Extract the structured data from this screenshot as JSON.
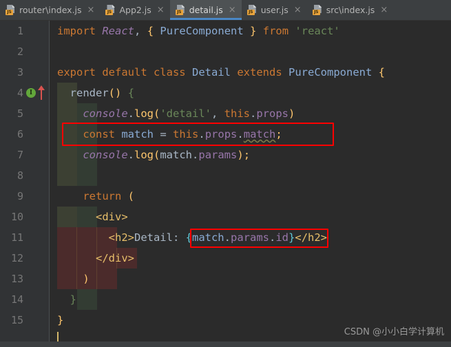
{
  "window": {
    "app": "IntelliJ-style code editor",
    "theme_bg": "#2b2b2b",
    "tabbar_bg": "#3c3f41",
    "active_tab_bg": "#4e5254",
    "active_tab_underline": "#4a88c7",
    "annotation_color": "#ff0000"
  },
  "tabs": [
    {
      "label": "router\\index.js",
      "icon": "js-file-icon",
      "badge": "JS",
      "close": "×",
      "active": false
    },
    {
      "label": "App2.js",
      "icon": "js-file-icon",
      "badge": "JS",
      "close": "×",
      "active": false
    },
    {
      "label": "detail.js",
      "icon": "js-file-icon",
      "badge": "JS",
      "close": "×",
      "active": true
    },
    {
      "label": "user.js",
      "icon": "js-file-icon",
      "badge": "JS",
      "close": "×",
      "active": false
    },
    {
      "label": "src\\index.js",
      "icon": "js-file-icon",
      "badge": "JS",
      "close": "×",
      "active": false
    }
  ],
  "gutter": {
    "line_numbers": [
      "1",
      "2",
      "3",
      "4",
      "5",
      "6",
      "7",
      "8",
      "9",
      "10",
      "11",
      "12",
      "13",
      "14",
      "15"
    ],
    "markers": [
      {
        "line": 4,
        "name": "implements-method-marker",
        "glyph": "I",
        "color": "#62a73b"
      },
      {
        "line": 4,
        "name": "override-up-arrow-marker",
        "glyph": "↑",
        "color": "#d9534f"
      }
    ],
    "fold_markers": [
      {
        "line": 3,
        "type": "collapse-start"
      },
      {
        "line": 4,
        "type": "collapse-start"
      },
      {
        "line": 10,
        "type": "collapse-start"
      },
      {
        "line": 12,
        "type": "collapse-end"
      },
      {
        "line": 14,
        "type": "collapse-end"
      },
      {
        "line": 15,
        "type": "collapse-end"
      }
    ]
  },
  "code": {
    "file": "detail.js",
    "lines": [
      {
        "n": 1,
        "text": "import React, { PureComponent } from 'react'"
      },
      {
        "n": 2,
        "text": ""
      },
      {
        "n": 3,
        "text": "export default class Detail extends PureComponent {"
      },
      {
        "n": 4,
        "text": "    render() {"
      },
      {
        "n": 5,
        "text": "        console.log('detail', this.props)"
      },
      {
        "n": 6,
        "text": "        const match = this.props.match;"
      },
      {
        "n": 7,
        "text": "        console.log(match.params);"
      },
      {
        "n": 8,
        "text": ""
      },
      {
        "n": 9,
        "text": "        return ("
      },
      {
        "n": 10,
        "text": "            <div>"
      },
      {
        "n": 11,
        "text": "                <h2>Detail: {match.params.id}</h2>"
      },
      {
        "n": 12,
        "text": "            </div>"
      },
      {
        "n": 13,
        "text": "        )"
      },
      {
        "n": 14,
        "text": "    }"
      },
      {
        "n": 15,
        "text": "}"
      }
    ]
  },
  "annotations": [
    {
      "name": "highlight-box-const-match",
      "target_line": 6,
      "note": "red rectangle around: const match = this.props.match;"
    },
    {
      "name": "highlight-box-match-params-id",
      "target_line": 11,
      "note": "red rectangle around: {match.params.id}"
    }
  ],
  "watermark": {
    "text": "CSDN @小小白学计算机"
  }
}
